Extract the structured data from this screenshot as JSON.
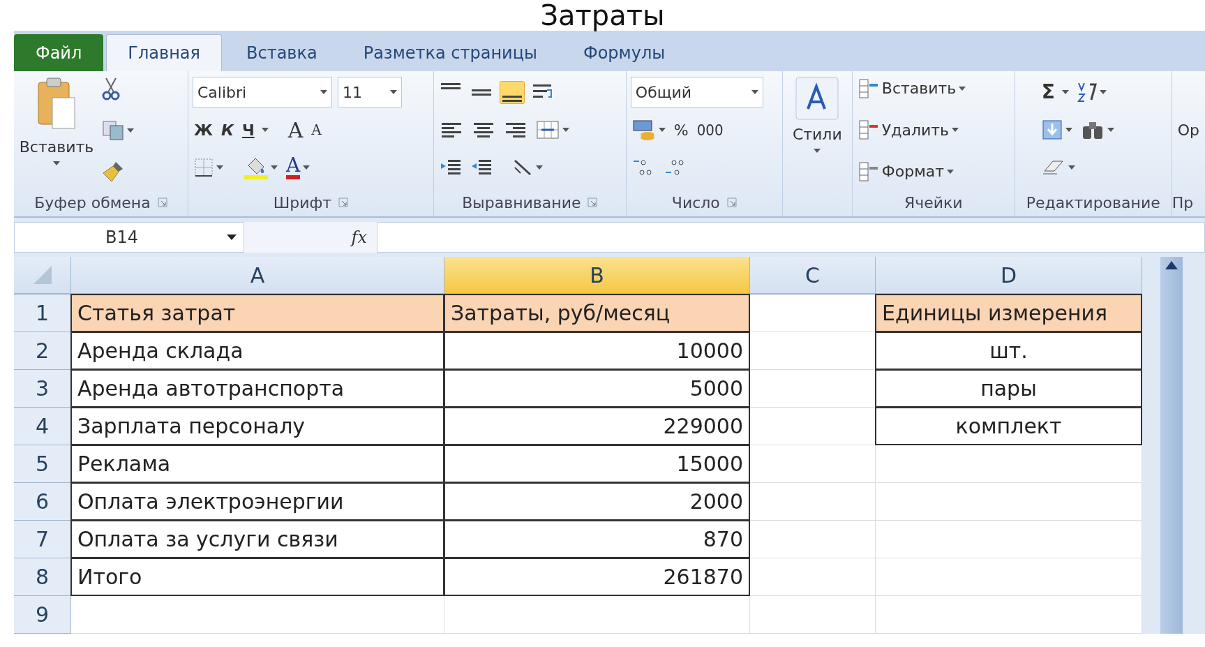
{
  "slide_title": "Затраты",
  "tabs": [
    {
      "label": "Файл",
      "kind": "file",
      "selected": false
    },
    {
      "label": "Главная",
      "kind": "tab",
      "selected": true
    },
    {
      "label": "Вставка",
      "kind": "tab",
      "selected": false
    },
    {
      "label": "Разметка страницы",
      "kind": "tab",
      "selected": false
    },
    {
      "label": "Формулы",
      "kind": "tab",
      "selected": false
    }
  ],
  "ribbon": {
    "clipboard": {
      "paste": "Вставить",
      "label": "Буфер обмена"
    },
    "font": {
      "family": "Calibri",
      "size": "11",
      "bold": "Ж",
      "italic": "К",
      "underline": "Ч",
      "grow": "A",
      "shrink": "A",
      "font_color_letter": "A",
      "label": "Шрифт"
    },
    "alignment": {
      "vertical": [
        {
          "selected": false
        },
        {
          "selected": false
        },
        {
          "selected": true
        }
      ],
      "label": "Выравнивание"
    },
    "number": {
      "format": "Общий",
      "percent": "%",
      "thousands": "000",
      "label": "Число"
    },
    "styles": {
      "button": "Стили"
    },
    "cells": {
      "buttons": [
        "Вставить",
        "Удалить",
        "Формат"
      ],
      "label": "Ячейки"
    },
    "editing": {
      "sum": "Σ",
      "label": "Редактирование"
    },
    "cut_button": "Ор",
    "cut_group_label": "Пр"
  },
  "formula_bar": {
    "name_box": "B14",
    "fx": "fx"
  },
  "sheet": {
    "columns": [
      {
        "label": "A",
        "selected": false
      },
      {
        "label": "B",
        "selected": true
      },
      {
        "label": "C",
        "selected": false
      },
      {
        "label": "D",
        "selected": false
      }
    ],
    "rows": [
      {
        "label": "1",
        "header": true,
        "cells": [
          {
            "text": "Статья затрат",
            "boxed": true
          },
          {
            "text": "Затраты, руб/месяц",
            "boxed": true
          },
          {
            "boxed": false
          },
          {
            "text": "Единицы измерения",
            "boxed": true
          }
        ]
      },
      {
        "label": "2",
        "header": false,
        "cells": [
          {
            "text": "Аренда склада",
            "boxed": true
          },
          {
            "text": "10000",
            "boxed": true
          },
          {
            "boxed": false
          },
          {
            "text": "шт.",
            "boxed": true
          }
        ]
      },
      {
        "label": "3",
        "header": false,
        "cells": [
          {
            "text": "Аренда автотранспорта",
            "boxed": true
          },
          {
            "text": "5000",
            "boxed": true
          },
          {
            "boxed": false
          },
          {
            "text": "пары",
            "boxed": true
          }
        ]
      },
      {
        "label": "4",
        "header": false,
        "cells": [
          {
            "text": "Зарплата персоналу",
            "boxed": true
          },
          {
            "text": "229000",
            "boxed": true
          },
          {
            "boxed": false
          },
          {
            "text": "комплект",
            "boxed": true
          }
        ]
      },
      {
        "label": "5",
        "header": false,
        "cells": [
          {
            "text": "Реклама",
            "boxed": true
          },
          {
            "text": "15000",
            "boxed": true
          },
          {
            "boxed": false
          },
          {
            "boxed": false
          }
        ]
      },
      {
        "label": "6",
        "header": false,
        "cells": [
          {
            "text": "Оплата электроэнергии",
            "boxed": true
          },
          {
            "text": "2000",
            "boxed": true
          },
          {
            "boxed": false
          },
          {
            "boxed": false
          }
        ]
      },
      {
        "label": "7",
        "header": false,
        "cells": [
          {
            "text": "Оплата за услуги связи",
            "boxed": true
          },
          {
            "text": "870",
            "boxed": true
          },
          {
            "boxed": false
          },
          {
            "boxed": false
          }
        ]
      },
      {
        "label": "8",
        "header": false,
        "cells": [
          {
            "text": "Итого",
            "boxed": true
          },
          {
            "text": "261870",
            "boxed": true
          },
          {
            "boxed": false
          },
          {
            "boxed": false
          }
        ]
      },
      {
        "label": "9",
        "header": false,
        "cells": [
          {
            "boxed": false
          },
          {
            "boxed": false
          },
          {
            "boxed": false
          },
          {
            "boxed": false
          }
        ]
      }
    ]
  }
}
